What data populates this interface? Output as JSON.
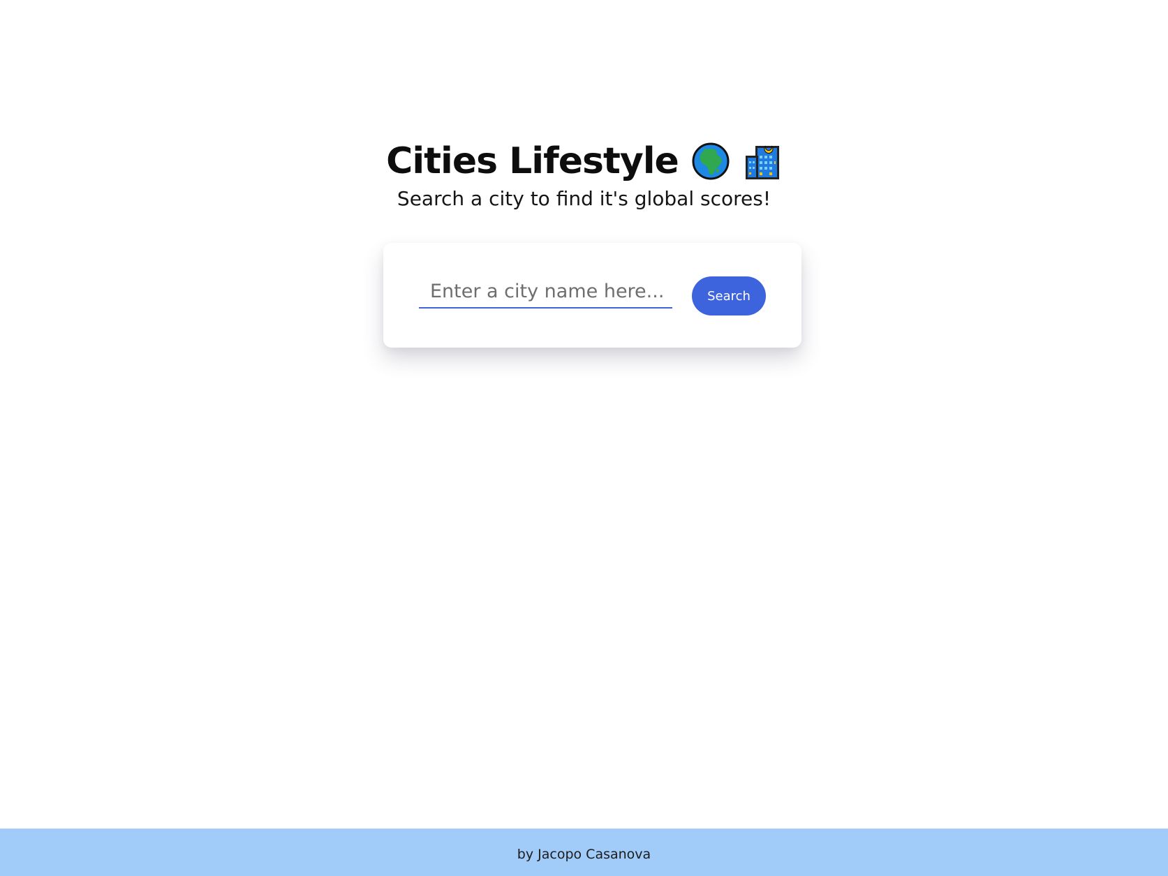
{
  "header": {
    "title": "Cities Lifestyle",
    "subtitle": "Search a city to find it's global scores!",
    "icons": [
      "globe-africa-icon",
      "city-building-icon"
    ]
  },
  "search": {
    "placeholder": "Enter a city name here...",
    "value": "",
    "button_label": "Search"
  },
  "footer": {
    "text": "by Jacopo Casanova"
  },
  "colors": {
    "accent": "#3d63dd",
    "footer_background": "#a1cbf8",
    "background": "#ffffff"
  }
}
